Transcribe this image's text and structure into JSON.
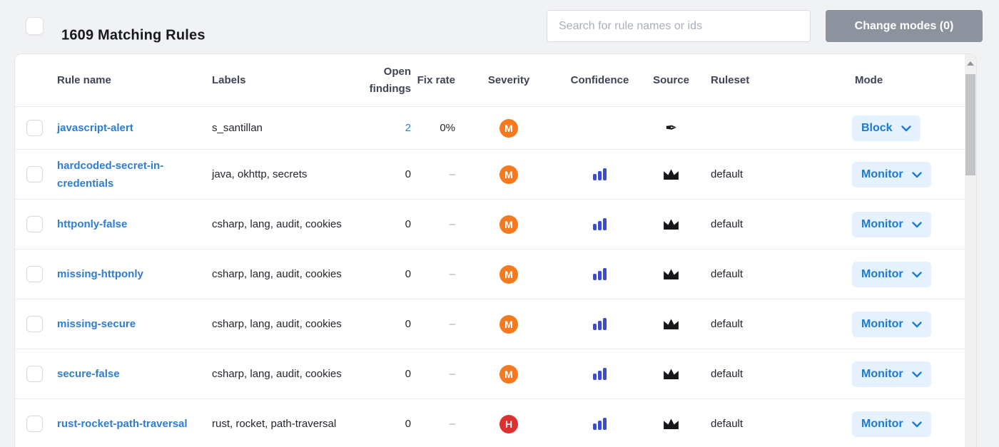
{
  "header": {
    "title": "1609 Matching Rules",
    "search_placeholder": "Search for rule names or ids",
    "change_modes_label": "Change modes (0)"
  },
  "table": {
    "columns": {
      "rule_name": "Rule name",
      "labels": "Labels",
      "open_findings": "Open findings",
      "fix_rate": "Fix rate",
      "severity": "Severity",
      "confidence": "Confidence",
      "source": "Source",
      "ruleset": "Ruleset",
      "mode": "Mode"
    },
    "rows": [
      {
        "rule_name": "javascript-alert",
        "labels": "s_santillan",
        "open_findings": "2",
        "fix_rate": "0%",
        "severity": "M",
        "confidence_icon": "",
        "source_icon": "pen-nib-icon",
        "ruleset": "",
        "mode": "Block"
      },
      {
        "rule_name": "hardcoded-secret-in-credentials",
        "labels": "java, okhttp, secrets",
        "open_findings": "0",
        "fix_rate": "–",
        "severity": "M",
        "confidence_icon": "bar-chart-icon",
        "source_icon": "crown-icon",
        "ruleset": "default",
        "mode": "Monitor"
      },
      {
        "rule_name": "httponly-false",
        "labels": "csharp, lang, audit, cookies",
        "open_findings": "0",
        "fix_rate": "–",
        "severity": "M",
        "confidence_icon": "bar-chart-icon",
        "source_icon": "crown-icon",
        "ruleset": "default",
        "mode": "Monitor"
      },
      {
        "rule_name": "missing-httponly",
        "labels": "csharp, lang, audit, cookies",
        "open_findings": "0",
        "fix_rate": "–",
        "severity": "M",
        "confidence_icon": "bar-chart-icon",
        "source_icon": "crown-icon",
        "ruleset": "default",
        "mode": "Monitor"
      },
      {
        "rule_name": "missing-secure",
        "labels": "csharp, lang, audit, cookies",
        "open_findings": "0",
        "fix_rate": "–",
        "severity": "M",
        "confidence_icon": "bar-chart-icon",
        "source_icon": "crown-icon",
        "ruleset": "default",
        "mode": "Monitor"
      },
      {
        "rule_name": "secure-false",
        "labels": "csharp, lang, audit, cookies",
        "open_findings": "0",
        "fix_rate": "–",
        "severity": "M",
        "confidence_icon": "bar-chart-icon",
        "source_icon": "crown-icon",
        "ruleset": "default",
        "mode": "Monitor"
      },
      {
        "rule_name": "rust-rocket-path-traversal",
        "labels": "rust, rocket, path-traversal",
        "open_findings": "0",
        "fix_rate": "–",
        "severity": "H",
        "confidence_icon": "bar-chart-icon",
        "source_icon": "crown-icon",
        "ruleset": "default",
        "mode": "Monitor"
      }
    ]
  },
  "colors": {
    "page_background": "#f1f2f4",
    "link_blue": "#2d7dd2",
    "mode_button_bg": "#e5f1fc",
    "mode_button_text": "#1b7bd4",
    "severity_medium": "#f4791f",
    "severity_high": "#dd3030",
    "confidence_bar_blue": "#3a4bd4",
    "change_modes_button_bg": "#8d939e"
  },
  "icons": {
    "source_custom": "pen-nib-icon",
    "source_pro": "crown-icon",
    "confidence": "bar-chart-icon",
    "mode_dropdown": "chevron-down-icon",
    "scroll_up": "triangle-up-icon"
  }
}
